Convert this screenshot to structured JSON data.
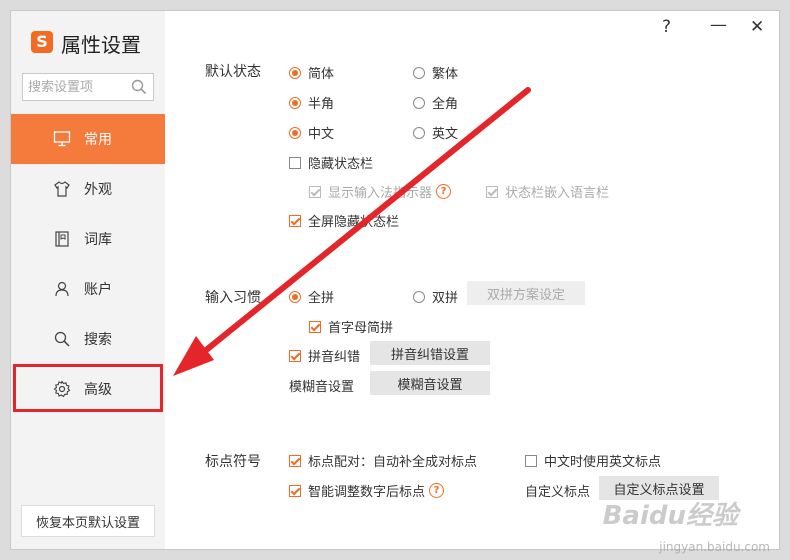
{
  "app": {
    "title": "属性设置",
    "logo_letter": "S"
  },
  "window_controls": {
    "help": "?",
    "minimize": "—",
    "close": "✕"
  },
  "search": {
    "placeholder": "搜索设置项"
  },
  "sidebar": {
    "items": [
      {
        "label": "常用",
        "icon": "monitor-icon",
        "active": true
      },
      {
        "label": "外观",
        "icon": "shirt-icon",
        "active": false
      },
      {
        "label": "词库",
        "icon": "book-icon",
        "active": false
      },
      {
        "label": "账户",
        "icon": "user-icon",
        "active": false
      },
      {
        "label": "搜索",
        "icon": "search-icon",
        "active": false
      },
      {
        "label": "高级",
        "icon": "gear-icon",
        "active": false,
        "highlighted": true
      }
    ],
    "restore_label": "恢复本页默认设置"
  },
  "default_state": {
    "title": "默认状态",
    "jianti": "简体",
    "fanti": "繁体",
    "banjiao": "半角",
    "quanjiao": "全角",
    "zhongwen": "中文",
    "yingwen": "英文",
    "hide_status": "隐藏状态栏",
    "show_indicator": "显示输入法指示器",
    "status_lang": "状态栏嵌入语言栏",
    "fullscreen_hide": "全屏隐藏状态栏"
  },
  "input_habit": {
    "title": "输入习惯",
    "quanpin": "全拼",
    "shuangpin": "双拼",
    "shuangpin_btn": "双拼方案设定",
    "shouzimu": "首字母简拼",
    "pinyin_correct": "拼音纠错",
    "pinyin_correct_btn": "拼音纠错设置",
    "fuzzy_label": "模糊音设置",
    "fuzzy_btn": "模糊音设置"
  },
  "punctuation": {
    "title": "标点符号",
    "pairing": "标点配对：自动补全成对标点",
    "english_punct": "中文时使用英文标点",
    "smart_adjust": "智能调整数字后标点",
    "custom_label": "自定义标点",
    "custom_btn": "自定义标点设置"
  },
  "watermark": {
    "text": "Baidu经验",
    "sub": "jingyan.baidu.com"
  },
  "colors": {
    "accent": "#f26b24",
    "active_nav": "#f47b3b",
    "annotation_red": "#e4262a"
  }
}
